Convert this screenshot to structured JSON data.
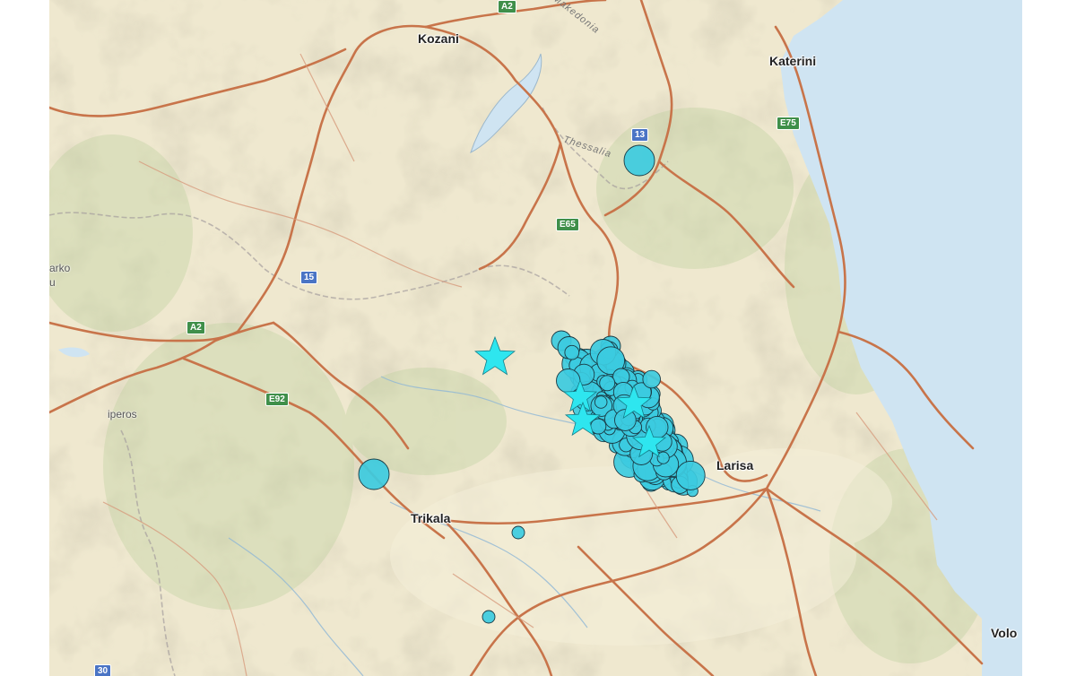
{
  "map": {
    "cities": {
      "kozani": "Kozani",
      "katerini": "Katerini",
      "larisa": "Larisa",
      "trikala": "Trikala",
      "volos": "Volo"
    },
    "minor_labels": {
      "arko": "arko",
      "u": "u",
      "iperos": "iperos",
      "thessalia": "Thessalia",
      "makedonia": "Makedonia"
    },
    "road_shields": {
      "a2_top": "A2",
      "a2_left": "A2",
      "e65": "E65",
      "e75": "E75",
      "e92": "E92",
      "r13": "13",
      "r15": "15",
      "r30": "30"
    },
    "colors": {
      "land": "#efe8cf",
      "sea": "#cfe4f2",
      "road": "#c8744a",
      "event_fill": "#3ccbe0",
      "event_stroke": "#1a3a44",
      "star_fill": "#2ee6ef"
    },
    "legend_symbols": {
      "event": "earthquake-circle",
      "mainshock": "earthquake-star"
    }
  }
}
